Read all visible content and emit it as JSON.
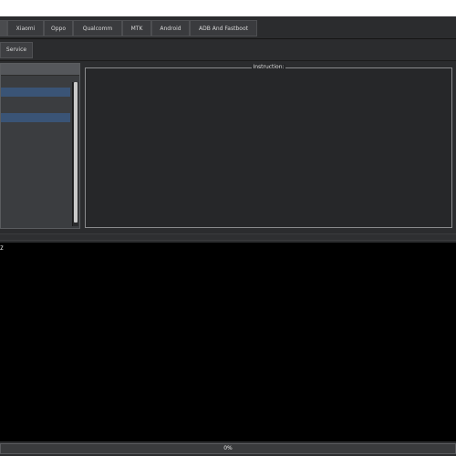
{
  "tabs": {
    "items": [
      {
        "label": ""
      },
      {
        "label": "Xiaomi"
      },
      {
        "label": "Oppo"
      },
      {
        "label": "Qualcomm"
      },
      {
        "label": "MTK"
      },
      {
        "label": "Android"
      },
      {
        "label": "ADB And Fastboot"
      }
    ]
  },
  "sub_tabs": {
    "items": [
      {
        "label": "Service"
      }
    ]
  },
  "instruction": {
    "title": "Instruction:"
  },
  "log": {
    "text": "Z"
  },
  "progress": {
    "value": 0,
    "label": "0%"
  },
  "colors": {
    "background": "#2b2c2e",
    "console": "#000000",
    "selection": "#3a5476",
    "progress_fill": "#3a6fb0"
  }
}
